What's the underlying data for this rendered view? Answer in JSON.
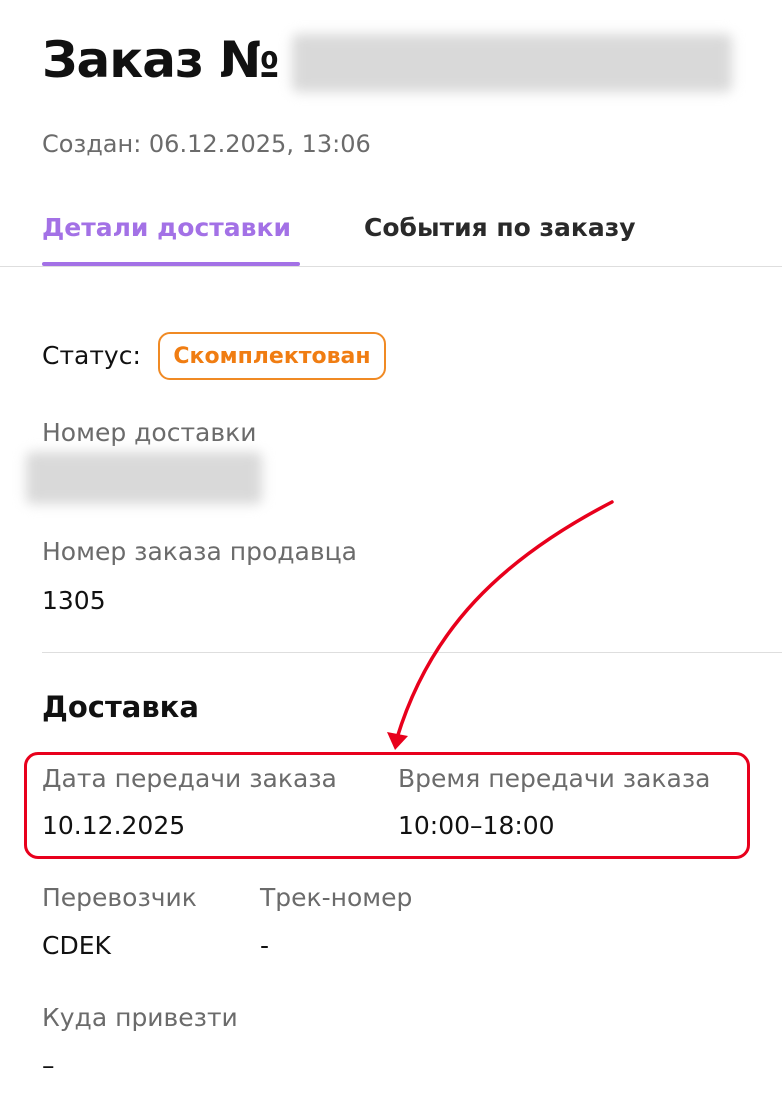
{
  "header": {
    "title": "Заказ №",
    "created": "Создан: 06.12.2025, 13:06"
  },
  "tabs": [
    {
      "label": "Детали доставки",
      "active": true
    },
    {
      "label": "События по заказу",
      "active": false
    }
  ],
  "status": {
    "label": "Статус:",
    "value": "Скомплектован",
    "color": "#f07d12"
  },
  "fields": {
    "delivery_number": {
      "label": "Номер доставки"
    },
    "seller_order_number": {
      "label": "Номер заказа продавца",
      "value": "1305"
    }
  },
  "delivery": {
    "title": "Доставка",
    "handover_date": {
      "label": "Дата передачи заказа",
      "value": "10.12.2025"
    },
    "handover_time": {
      "label": "Время передачи заказа",
      "value": "10:00–18:00"
    },
    "carrier": {
      "label": "Перевозчик",
      "value": "CDEK"
    },
    "track": {
      "label": "Трек-номер",
      "value": "-"
    },
    "address": {
      "label": "Куда привезти",
      "value": "–"
    }
  },
  "colors": {
    "accent": "#a371e6",
    "annotation": "#e8001c"
  }
}
